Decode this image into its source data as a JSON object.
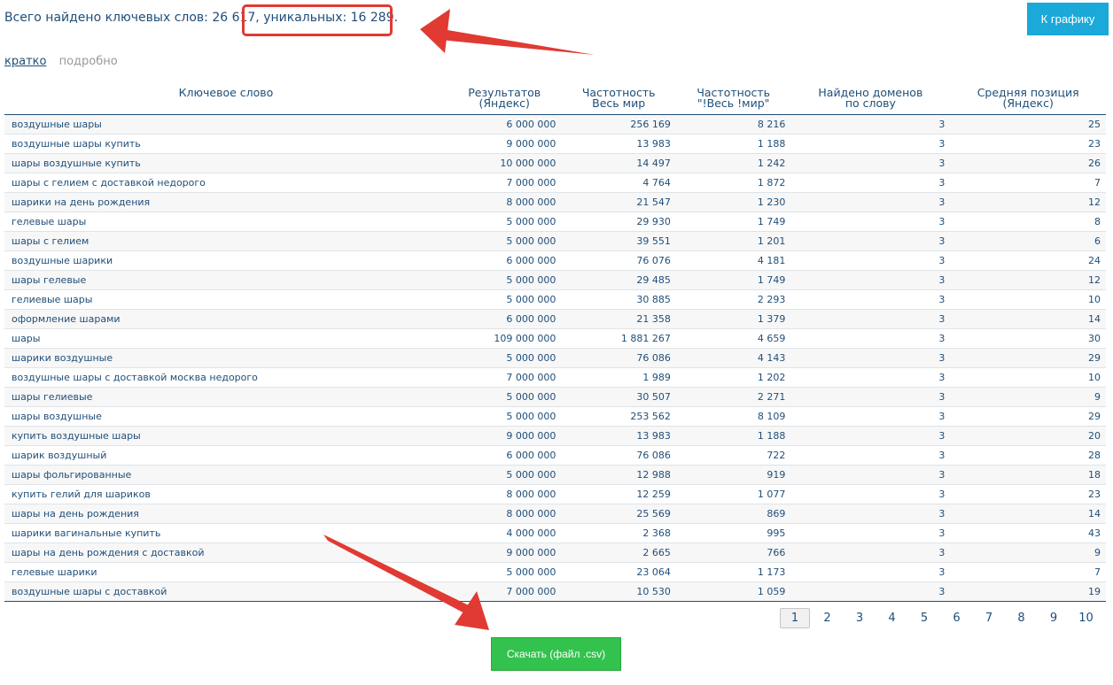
{
  "summary": {
    "text": "Всего найдено ключевых слов: 26 617, уникальных: 16 289."
  },
  "buttons": {
    "chart": "К графику",
    "download": "Скачать (файл .csv)"
  },
  "view": {
    "brief": "кратко",
    "detailed": "подробно"
  },
  "table": {
    "headers": {
      "keyword": "Ключевое слово",
      "results_1": "Результатов",
      "results_2": "(Яндекс)",
      "freq_1": "Частотность",
      "freq_2": "Весь мир",
      "freq_ex_1": "Частотность",
      "freq_ex_2": "\"!Весь !мир\"",
      "domains_1": "Найдено доменов",
      "domains_2": "по слову",
      "pos_1": "Средняя позиция",
      "pos_2": "(Яндекс)"
    },
    "rows": [
      [
        "воздушные шары",
        "6 000 000",
        "256 169",
        "8 216",
        "3",
        "25"
      ],
      [
        "воздушные шары купить",
        "9 000 000",
        "13 983",
        "1 188",
        "3",
        "23"
      ],
      [
        "шары воздушные купить",
        "10 000 000",
        "14 497",
        "1 242",
        "3",
        "26"
      ],
      [
        "шары с гелием с доставкой недорого",
        "7 000 000",
        "4 764",
        "1 872",
        "3",
        "7"
      ],
      [
        "шарики на день рождения",
        "8 000 000",
        "21 547",
        "1 230",
        "3",
        "12"
      ],
      [
        "гелевые шары",
        "5 000 000",
        "29 930",
        "1 749",
        "3",
        "8"
      ],
      [
        "шары с гелием",
        "5 000 000",
        "39 551",
        "1 201",
        "3",
        "6"
      ],
      [
        "воздушные шарики",
        "6 000 000",
        "76 076",
        "4 181",
        "3",
        "24"
      ],
      [
        "шары гелевые",
        "5 000 000",
        "29 485",
        "1 749",
        "3",
        "12"
      ],
      [
        "гелиевые шары",
        "5 000 000",
        "30 885",
        "2 293",
        "3",
        "10"
      ],
      [
        "оформление шарами",
        "6 000 000",
        "21 358",
        "1 379",
        "3",
        "14"
      ],
      [
        "шары",
        "109 000 000",
        "1 881 267",
        "4 659",
        "3",
        "30"
      ],
      [
        "шарики воздушные",
        "5 000 000",
        "76 086",
        "4 143",
        "3",
        "29"
      ],
      [
        "воздушные шары с доставкой москва недорого",
        "7 000 000",
        "1 989",
        "1 202",
        "3",
        "10"
      ],
      [
        "шары гелиевые",
        "5 000 000",
        "30 507",
        "2 271",
        "3",
        "9"
      ],
      [
        "шары воздушные",
        "5 000 000",
        "253 562",
        "8 109",
        "3",
        "29"
      ],
      [
        "купить воздушные шары",
        "9 000 000",
        "13 983",
        "1 188",
        "3",
        "20"
      ],
      [
        "шарик воздушный",
        "6 000 000",
        "76 086",
        "722",
        "3",
        "28"
      ],
      [
        "шары фольгированные",
        "5 000 000",
        "12 988",
        "919",
        "3",
        "18"
      ],
      [
        "купить гелий для шариков",
        "8 000 000",
        "12 259",
        "1 077",
        "3",
        "23"
      ],
      [
        "шары на день рождения",
        "8 000 000",
        "25 569",
        "869",
        "3",
        "14"
      ],
      [
        "шарики вагинальные купить",
        "4 000 000",
        "2 368",
        "995",
        "3",
        "43"
      ],
      [
        "шары на день рождения с доставкой",
        "9 000 000",
        "2 665",
        "766",
        "3",
        "9"
      ],
      [
        "гелевые шарики",
        "5 000 000",
        "23 064",
        "1 173",
        "3",
        "7"
      ],
      [
        "воздушные шары с доставкой",
        "7 000 000",
        "10 530",
        "1 059",
        "3",
        "19"
      ]
    ]
  },
  "pagination": {
    "current": "1",
    "pages": [
      "1",
      "2",
      "3",
      "4",
      "5",
      "6",
      "7",
      "8",
      "9",
      "10"
    ]
  },
  "annotations": {
    "arrow_color": "#e03a33",
    "box_color": "#e03a33"
  }
}
